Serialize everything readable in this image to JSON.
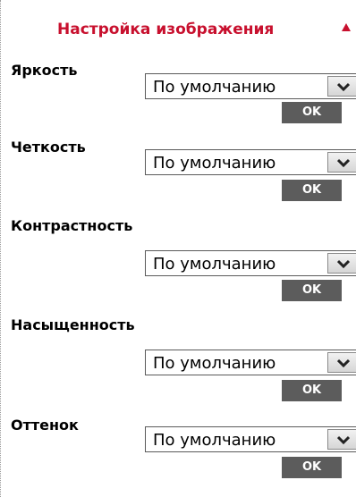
{
  "header": {
    "title": "Настройка изображения",
    "collapse_icon": "triangle-up-icon",
    "accent_color": "#c8102e"
  },
  "settings": [
    {
      "label": "Яркость",
      "value": "По умолчанию",
      "button": "OK"
    },
    {
      "label": "Четкость",
      "value": "По умолчанию",
      "button": "OK"
    },
    {
      "label": "Контрастность",
      "value": "По умолчанию",
      "button": "OK"
    },
    {
      "label": "Насыщенность",
      "value": "По умолчанию",
      "button": "OK"
    },
    {
      "label": "Оттенок",
      "value": "По умолчанию",
      "button": "OK"
    }
  ]
}
